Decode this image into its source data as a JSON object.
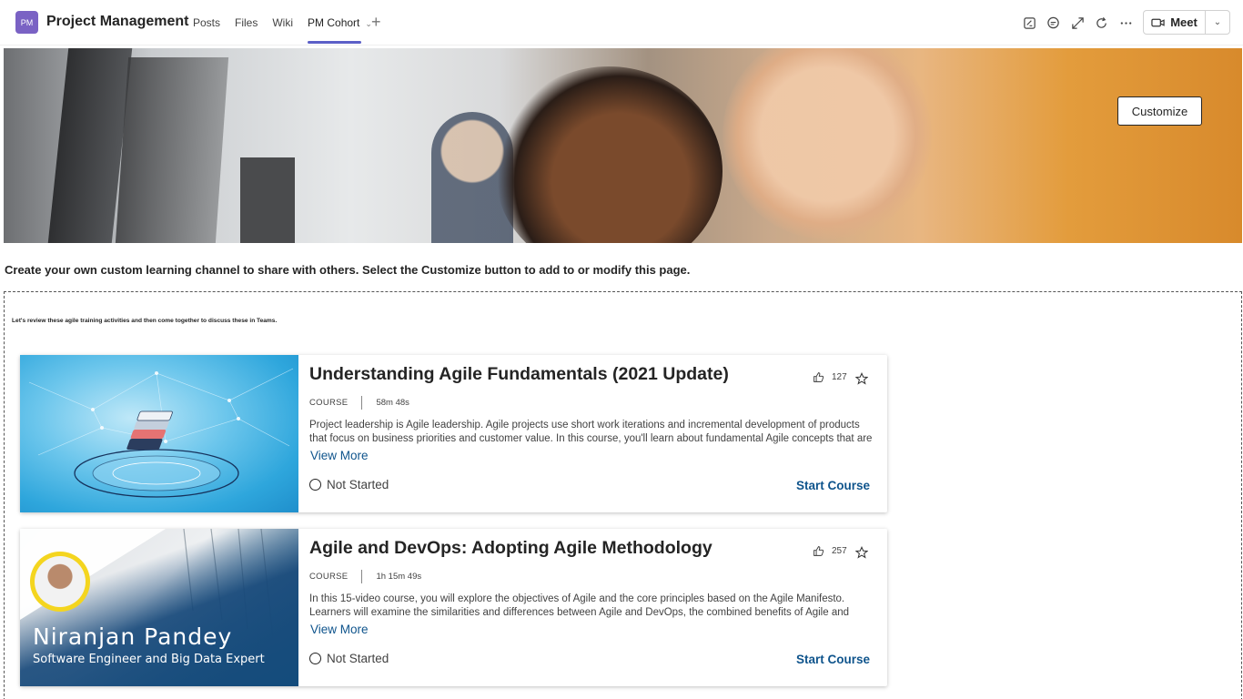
{
  "header": {
    "team_initials": "PM",
    "team_name": "Project Management",
    "tabs": [
      {
        "label": "Posts"
      },
      {
        "label": "Files"
      },
      {
        "label": "Wiki"
      },
      {
        "label": "PM Cohort"
      }
    ],
    "meet_label": "Meet",
    "icons": [
      "whiteboard-icon",
      "chat-icon",
      "expand-icon",
      "refresh-icon",
      "more-icon"
    ]
  },
  "banner": {
    "customize_label": "Customize"
  },
  "intro_text": "Create your own custom learning channel to share with others. Select the Customize button to add to or modify this page.",
  "section_note": "Let's review these agile training activities and then come together to discuss these in Teams.",
  "courses": [
    {
      "title": "Understanding Agile Fundamentals (2021 Update)",
      "type": "COURSE",
      "duration": "58m 48s",
      "likes": "127",
      "description": "Project leadership is Agile leadership. Agile projects use short work iterations and incremental development of products that focus on business priorities and customer value. In this course, you'll learn about fundamental Agile concepts that are essential...",
      "view_more": "View More",
      "status": "Not Started",
      "action": "Start Course"
    },
    {
      "title": "Agile and DevOps: Adopting Agile Methodology",
      "type": "COURSE",
      "duration": "1h 15m 49s",
      "likes": "257",
      "description": "In this 15-video course, you will explore the objectives of Agile and the core principles based on the Agile Manifesto. Learners will examine the similarities and differences between Agile and DevOps, the combined benefits of Agile and DevOps in managi...",
      "view_more": "View More",
      "status": "Not Started",
      "action": "Start Course",
      "instructor_name": "Niranjan Pandey",
      "instructor_role": "Software Engineer and Big Data Expert"
    }
  ],
  "colors": {
    "accent": "#5b5fc7",
    "link": "#0f548c",
    "avatar": "#7a62c4"
  }
}
